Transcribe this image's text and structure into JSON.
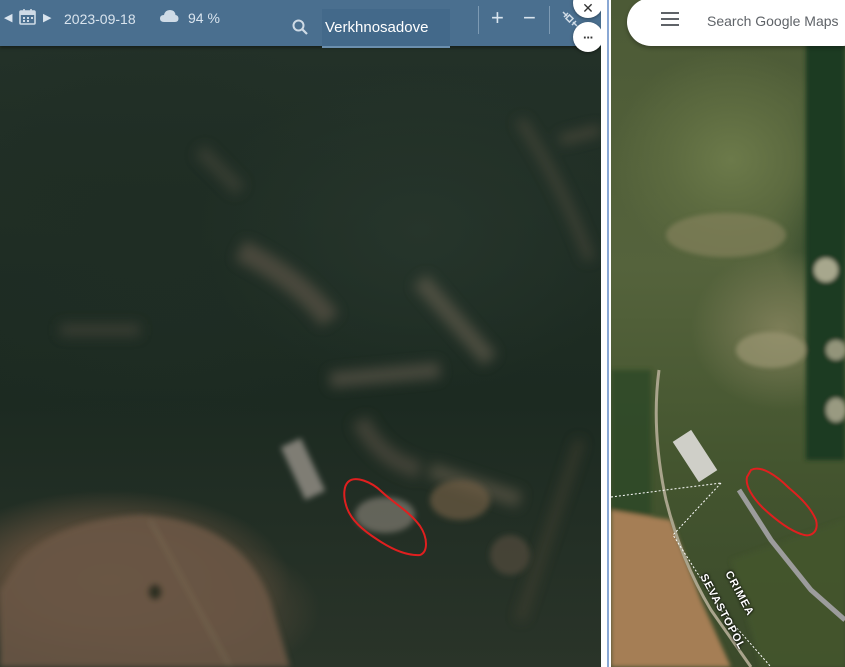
{
  "toolbar": {
    "date": "2023-09-18",
    "cloud_cover": "94 %",
    "search_value": "Verkhnosadove",
    "zoom_in": "+",
    "zoom_out": "−",
    "more": "···",
    "icons": [
      "triangle-left-icon",
      "calendar-icon",
      "triangle-right-icon",
      "cloud-icon",
      "search-icon",
      "satellite-icon",
      "close-icon"
    ]
  },
  "gmaps": {
    "search_placeholder": "Search Google Maps",
    "road_labels": [
      "CRIMEA",
      "SEVASTOPOL"
    ]
  },
  "colors": {
    "toolbar_bg": "#4a6f8f",
    "outline": "#e01f1f"
  }
}
